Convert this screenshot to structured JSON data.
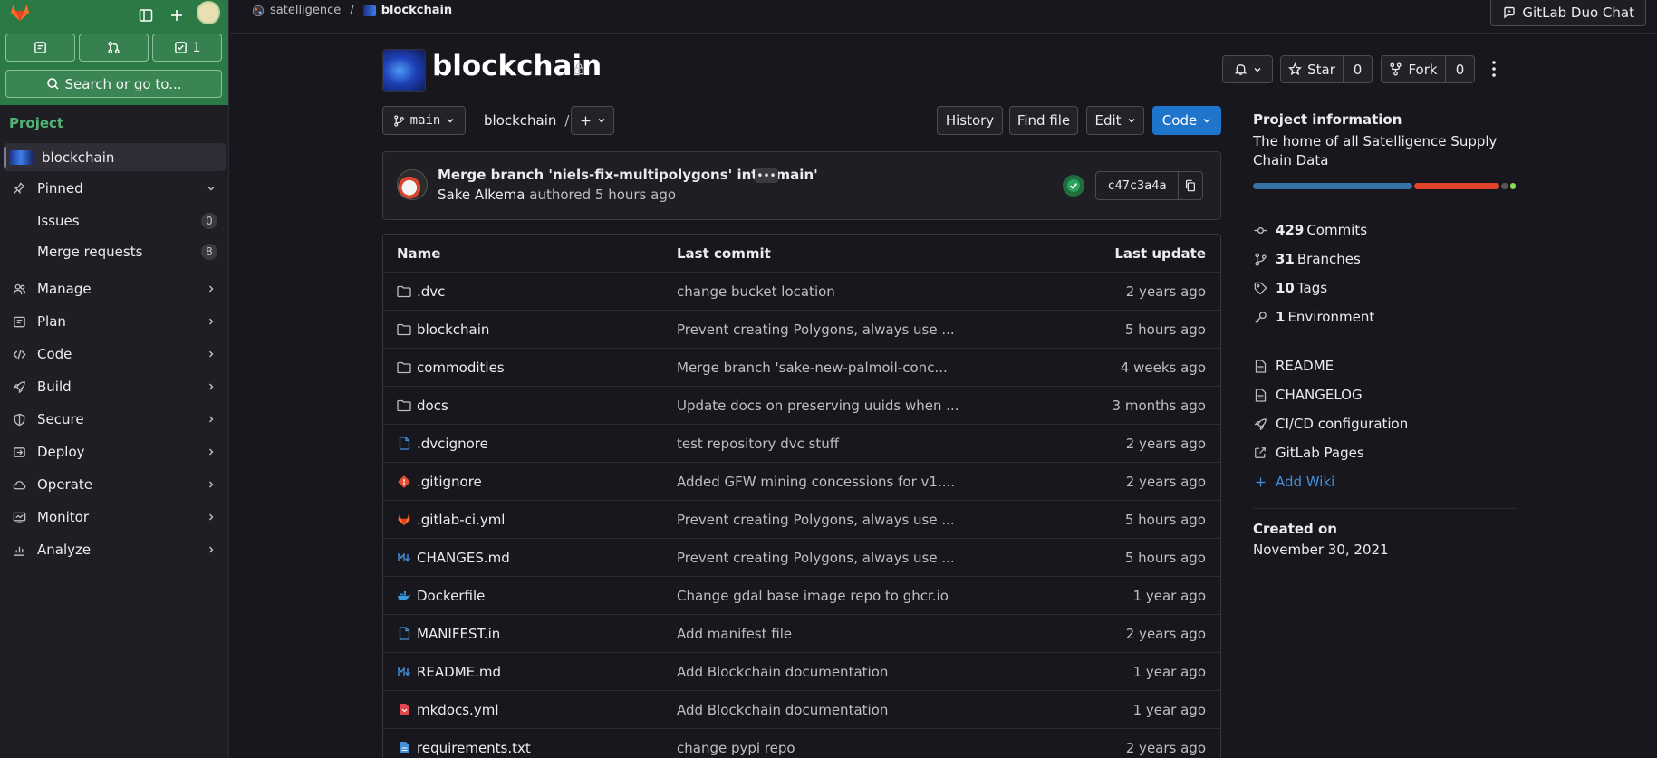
{
  "sidebar": {
    "todo_count": "1",
    "search_label": "Search or go to...",
    "section_label": "Project",
    "project_name": "blockchain",
    "pinned_label": "Pinned",
    "pinned_items": [
      {
        "label": "Issues",
        "count": "0"
      },
      {
        "label": "Merge requests",
        "count": "8"
      }
    ],
    "nav": [
      {
        "label": "Manage",
        "icon": "users-icon"
      },
      {
        "label": "Plan",
        "icon": "planning-icon"
      },
      {
        "label": "Code",
        "icon": "code-icon"
      },
      {
        "label": "Build",
        "icon": "rocket-icon"
      },
      {
        "label": "Secure",
        "icon": "shield-icon"
      },
      {
        "label": "Deploy",
        "icon": "deployments-icon"
      },
      {
        "label": "Operate",
        "icon": "cloud-icon"
      },
      {
        "label": "Monitor",
        "icon": "monitor-icon"
      },
      {
        "label": "Analyze",
        "icon": "chart-icon"
      }
    ]
  },
  "topbar": {
    "breadcrumb": [
      "satelligence",
      "blockchain"
    ],
    "duo_label": "GitLab Duo Chat"
  },
  "header": {
    "title": "blockchain",
    "star_label": "Star",
    "star_count": "0",
    "fork_label": "Fork",
    "fork_count": "0"
  },
  "toolbar": {
    "branch": "main",
    "path": "blockchain",
    "path_sep": "/",
    "history": "History",
    "find_file": "Find file",
    "edit": "Edit",
    "code": "Code"
  },
  "commit": {
    "message": "Merge branch 'niels-fix-multipolygons' into 'main'",
    "author": "Sake Alkema",
    "meta": "authored 5 hours ago",
    "sha": "c47c3a4a",
    "status": "success"
  },
  "files": {
    "columns": [
      "Name",
      "Last commit",
      "Last update"
    ],
    "rows": [
      {
        "name": ".dvc",
        "icon": "folder-icon",
        "commit": "change bucket location",
        "updated": "2 years ago"
      },
      {
        "name": "blockchain",
        "icon": "folder-icon",
        "commit": "Prevent creating Polygons, always use ...",
        "updated": "5 hours ago"
      },
      {
        "name": "commodities",
        "icon": "folder-icon",
        "commit": "Merge branch 'sake-new-palmoil-conc...",
        "updated": "4 weeks ago"
      },
      {
        "name": "docs",
        "icon": "folder-icon",
        "commit": "Update docs on preserving uuids when ...",
        "updated": "3 months ago"
      },
      {
        "name": ".dvcignore",
        "icon": "file-icon",
        "commit": "test repository dvc stuff",
        "updated": "2 years ago"
      },
      {
        "name": ".gitignore",
        "icon": "git-icon",
        "commit": "Added GFW mining concessions for v1....",
        "updated": "2 years ago"
      },
      {
        "name": ".gitlab-ci.yml",
        "icon": "gitlab-icon",
        "commit": "Prevent creating Polygons, always use ...",
        "updated": "5 hours ago"
      },
      {
        "name": "CHANGES.md",
        "icon": "markdown-icon",
        "commit": "Prevent creating Polygons, always use ...",
        "updated": "5 hours ago"
      },
      {
        "name": "Dockerfile",
        "icon": "docker-icon",
        "commit": "Change gdal base image repo to ghcr.io",
        "updated": "1 year ago"
      },
      {
        "name": "MANIFEST.in",
        "icon": "file-icon",
        "commit": "Add manifest file",
        "updated": "2 years ago"
      },
      {
        "name": "README.md",
        "icon": "markdown-icon",
        "commit": "Add Blockchain documentation",
        "updated": "1 year ago"
      },
      {
        "name": "mkdocs.yml",
        "icon": "yaml-icon",
        "commit": "Add Blockchain documentation",
        "updated": "1 year ago"
      },
      {
        "name": "requirements.txt",
        "icon": "file-icon",
        "commit": "change pypi repo",
        "updated": "2 years ago"
      }
    ]
  },
  "info": {
    "heading": "Project information",
    "description": "The home of all Satelligence Supply Chain Data",
    "languages": [
      {
        "color": "#3572a5",
        "share": 0.62
      },
      {
        "color": "#e24329",
        "share": 0.33
      },
      {
        "color": "#555555",
        "share": 0.03
      },
      {
        "color": "#89e051",
        "share": 0.02
      }
    ],
    "stats": [
      {
        "count": "429",
        "label": "Commits",
        "icon": "commit-icon"
      },
      {
        "count": "31",
        "label": "Branches",
        "icon": "branch-icon"
      },
      {
        "count": "10",
        "label": "Tags",
        "icon": "tag-icon"
      },
      {
        "count": "1",
        "label": "Environment",
        "icon": "environment-icon"
      }
    ],
    "links": [
      {
        "label": "README",
        "icon": "doc-icon"
      },
      {
        "label": "CHANGELOG",
        "icon": "doc-icon"
      },
      {
        "label": "CI/CD configuration",
        "icon": "rocket-icon"
      },
      {
        "label": "GitLab Pages",
        "icon": "external-link-icon"
      },
      {
        "label": "Add Wiki",
        "icon": "plus-icon"
      }
    ],
    "created_label": "Created on",
    "created_date": "November 30, 2021"
  }
}
